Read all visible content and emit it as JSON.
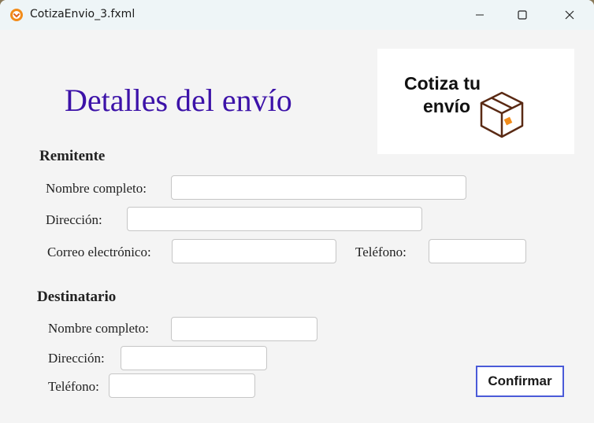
{
  "window": {
    "title": "CotizaEnvio_3.fxml",
    "icons": {
      "app": "app-icon",
      "minimize": "minimize-icon",
      "maximize": "maximize-icon",
      "close": "close-icon"
    }
  },
  "heading": "Detalles del envío",
  "logo": {
    "line1": "Cotiza tu",
    "line2": "envío",
    "icon": "box-icon"
  },
  "remitente": {
    "title": "Remitente",
    "name_label": "Nombre completo:",
    "name_value": "",
    "address_label": "Dirección:",
    "address_value": "",
    "email_label": "Correo electrónico:",
    "email_value": "",
    "phone_label": "Teléfono:",
    "phone_value": ""
  },
  "destinatario": {
    "title": "Destinatario",
    "name_label": "Nombre completo:",
    "name_value": "",
    "address_label": "Dirección:",
    "address_value": "",
    "phone_label": "Teléfono:",
    "phone_value": ""
  },
  "confirm_label": "Confirmar",
  "colors": {
    "heading": "#3c12a8",
    "confirm_border": "#4a5ad8",
    "icon_orange": "#f28c1a",
    "box_brown": "#5a2a14"
  }
}
